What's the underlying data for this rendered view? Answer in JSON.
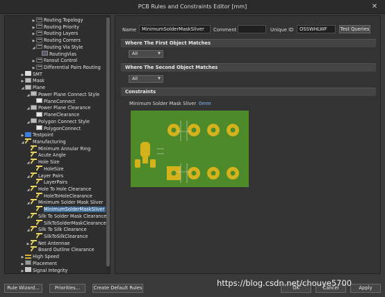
{
  "window": {
    "title": "PCB Rules and Constraints Editor [mm]",
    "close_glyph": "✕"
  },
  "tree": {
    "rows": [
      {
        "label": "Routing Topology",
        "icon": "route"
      },
      {
        "label": "Routing Priority",
        "icon": "route"
      },
      {
        "label": "Routing Layers",
        "icon": "route"
      },
      {
        "label": "Routing Corners",
        "icon": "route"
      },
      {
        "label": "Routing Via Style",
        "icon": "route"
      },
      {
        "label": "RoutingVias",
        "icon": "route2"
      },
      {
        "label": "Fanout Control",
        "icon": "route"
      },
      {
        "label": "Differential Pairs Routing",
        "icon": "route"
      },
      {
        "label": "SMT",
        "icon": "smt"
      },
      {
        "label": "Mask",
        "icon": "grey"
      },
      {
        "label": "Plane",
        "icon": "grey"
      },
      {
        "label": "Power Plane Connect Style",
        "icon": "grey"
      },
      {
        "label": "PlaneConnect",
        "icon": "doc"
      },
      {
        "label": "Power Plane Clearance",
        "icon": "grey"
      },
      {
        "label": "PlaneClearance",
        "icon": "doc"
      },
      {
        "label": "Polygon Connect Style",
        "icon": "grey"
      },
      {
        "label": "PolygonConnect",
        "icon": "doc"
      },
      {
        "label": "Testpoint",
        "icon": "test"
      },
      {
        "label": "Manufacturing",
        "icon": "mfg"
      },
      {
        "label": "Minimum Annular Ring",
        "icon": "mfg"
      },
      {
        "label": "Acute Angle",
        "icon": "mfg"
      },
      {
        "label": "Hole Size",
        "icon": "mfg"
      },
      {
        "label": "HoleSize",
        "icon": "mfg"
      },
      {
        "label": "Layer Pairs",
        "icon": "mfg"
      },
      {
        "label": "LayerPairs",
        "icon": "mfg"
      },
      {
        "label": "Hole To Hole Clearance",
        "icon": "mfg"
      },
      {
        "label": "HoleToHoleClearance",
        "icon": "mfg"
      },
      {
        "label": "Minimum Solder Mask Sliver",
        "icon": "mfg"
      },
      {
        "label": "MinimumSolderMaskSliver",
        "icon": "mfg"
      },
      {
        "label": "Silk To Solder Mask Clearance",
        "icon": "mfg"
      },
      {
        "label": "SilkToSolderMaskClearance",
        "icon": "mfg"
      },
      {
        "label": "Silk To Silk Clearance",
        "icon": "mfg"
      },
      {
        "label": "SilkToSilkClearance",
        "icon": "mfg"
      },
      {
        "label": "Net Antennae",
        "icon": "mfg"
      },
      {
        "label": "Board Outline Clearance",
        "icon": "mfg"
      },
      {
        "label": "High Speed",
        "icon": "hs"
      },
      {
        "label": "Placement",
        "icon": "place"
      },
      {
        "label": "Signal Integrity",
        "icon": "sig"
      }
    ]
  },
  "rule": {
    "name_label": "Name",
    "name_value": "MinimumSolderMaskSliver",
    "comment_label": "Comment",
    "comment_value": "",
    "uid_label": "Unique ID",
    "uid_value": "OSSWHLWF",
    "test_queries": "Test Queries"
  },
  "first_match": {
    "heading": "Where The First Object Matches",
    "selected": "All"
  },
  "second_match": {
    "heading": "Where The Second Object Matches",
    "selected": "All"
  },
  "constraints": {
    "heading": "Constraints",
    "sliver_label": "Minimum Solder Mask Sliver",
    "sliver_value": "0mm"
  },
  "buttons": {
    "rule_wizard": "Rule Wizard...",
    "priorities": "Priorities...",
    "create_default": "Create Default Rules",
    "ok": "OK",
    "cancel": "Cancel",
    "apply": "Apply"
  },
  "watermark": "https://blog.csdn.net/chouye5700",
  "colors": {
    "board": "#4e8a2a",
    "pad": "#d4b21c",
    "selection": "#3f6c98"
  }
}
